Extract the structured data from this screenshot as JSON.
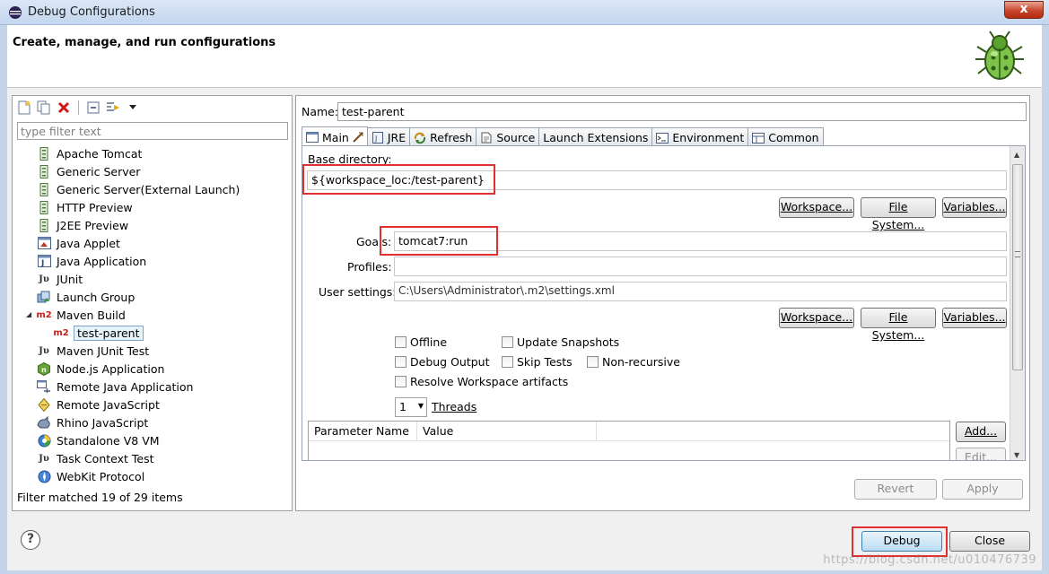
{
  "window": {
    "title": "Debug Configurations",
    "close_glyph": "x",
    "banner_title": "Create, manage, and run configurations"
  },
  "left": {
    "filter_placeholder": "type filter text",
    "items": [
      {
        "label": "Apache Tomcat",
        "icon": "server-icon"
      },
      {
        "label": "Generic Server",
        "icon": "server-icon"
      },
      {
        "label": "Generic Server(External Launch)",
        "icon": "server-icon"
      },
      {
        "label": "HTTP Preview",
        "icon": "server-icon"
      },
      {
        "label": "J2EE Preview",
        "icon": "server-icon"
      },
      {
        "label": "Java Applet",
        "icon": "applet-icon"
      },
      {
        "label": "Java Application",
        "icon": "java-app-icon"
      },
      {
        "label": "JUnit",
        "icon": "junit-icon"
      },
      {
        "label": "Launch Group",
        "icon": "launch-group-icon"
      },
      {
        "label": "Maven Build",
        "icon": "maven-icon"
      },
      {
        "label": "test-parent",
        "icon": "maven-icon"
      },
      {
        "label": "Maven JUnit Test",
        "icon": "junit-icon"
      },
      {
        "label": "Node.js Application",
        "icon": "nodejs-icon"
      },
      {
        "label": "Remote Java Application",
        "icon": "remote-java-icon"
      },
      {
        "label": "Remote JavaScript",
        "icon": "remote-js-icon"
      },
      {
        "label": "Rhino JavaScript",
        "icon": "rhino-icon"
      },
      {
        "label": "Standalone V8 VM",
        "icon": "v8-icon"
      },
      {
        "label": "Task Context Test",
        "icon": "junit-icon"
      },
      {
        "label": "WebKit Protocol",
        "icon": "webkit-icon"
      }
    ],
    "icon_text": {
      "maven": "m2",
      "junit": "Jυ"
    },
    "status": "Filter matched 19 of 29 items"
  },
  "right": {
    "name_label": "Name:",
    "name_value": "test-parent",
    "tabs": [
      {
        "label": "Main"
      },
      {
        "label": "JRE"
      },
      {
        "label": "Refresh"
      },
      {
        "label": "Source"
      },
      {
        "label": "Launch Extensions"
      },
      {
        "label": "Environment"
      },
      {
        "label": "Common"
      }
    ],
    "base_dir_label": "Base directory:",
    "base_dir_value": "${workspace_loc:/test-parent}",
    "workspace_btn": "Workspace...",
    "filesystem_btn": "File System...",
    "variables_btn": "Variables...",
    "goals_label": "Goals:",
    "goals_value": "tomcat7:run",
    "profiles_label": "Profiles:",
    "profiles_value": "",
    "user_settings_label": "User settings:",
    "user_settings_value": "C:\\Users\\Administrator\\.m2\\settings.xml",
    "checkboxes": {
      "offline": "Offline",
      "update_snapshots": "Update Snapshots",
      "debug_output": "Debug Output",
      "skip_tests": "Skip Tests",
      "non_recursive": "Non-recursive",
      "resolve_workspace": "Resolve Workspace artifacts"
    },
    "threads_value": "1",
    "threads_label": "Threads",
    "param_col_name": "Parameter Name",
    "param_col_value": "Value",
    "add_btn": "Add...",
    "edit_btn": "Edit...",
    "revert_btn": "Revert",
    "apply_btn": "Apply"
  },
  "footer": {
    "help_glyph": "?",
    "debug_btn": "Debug",
    "close_btn": "Close",
    "watermark": "https://blog.csdn.net/u010476739"
  }
}
